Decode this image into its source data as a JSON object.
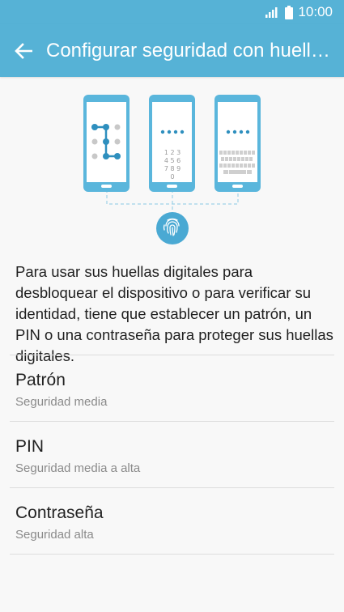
{
  "status_bar": {
    "time": "10:00",
    "signal_icon": "signal-icon",
    "battery_icon": "battery-icon"
  },
  "app_bar": {
    "title": "Configurar seguridad con huellas...",
    "back_icon": "arrow-left-icon"
  },
  "illustration": {
    "pin_digits": [
      "1 2 3",
      "4 5 6",
      "7 8 9",
      "0"
    ],
    "fingerprint_icon": "fingerprint-icon"
  },
  "description": "Para usar sus huellas digitales para desbloquear el dispositivo o para verificar su identidad, tiene que establecer un patrón, un PIN o una contraseña para proteger sus huellas digitales.",
  "options": [
    {
      "title": "Patrón",
      "subtitle": "Seguridad media"
    },
    {
      "title": "PIN",
      "subtitle": "Seguridad media a alta"
    },
    {
      "title": "Contraseña",
      "subtitle": "Seguridad alta"
    }
  ],
  "colors": {
    "accent": "#56b2d6",
    "phone_body": "#5ab6dc",
    "background": "#f8f8f8"
  }
}
